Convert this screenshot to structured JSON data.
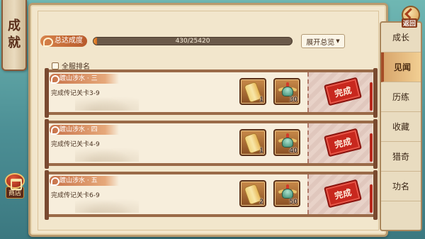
{
  "title_chars": [
    "成",
    "就"
  ],
  "shop": {
    "label": "商店"
  },
  "back": {
    "label": "返回"
  },
  "progress": {
    "label": "总达成度",
    "text": "430/25420",
    "fraction": 0.0169
  },
  "expand": {
    "label": "展开总览"
  },
  "server_rank": {
    "label": "全服排名"
  },
  "rows": [
    {
      "title": "踱山涉水 · 三",
      "desc": "完成传记关卡3-9",
      "reward1_count": "1",
      "reward2_count": "30",
      "stamp": "完成"
    },
    {
      "title": "踱山涉水 · 四",
      "desc": "完成传记关卡4-9",
      "reward1_count": "1",
      "reward2_count": "40",
      "stamp": "完成"
    },
    {
      "title": "踱山涉水 · 五",
      "desc": "完成传记关卡6-9",
      "reward1_count": "2",
      "reward2_count": "50",
      "stamp": "完成"
    }
  ],
  "nav": [
    "成长",
    "见闻",
    "历练",
    "收藏",
    "猎奇",
    "功名"
  ],
  "nav_active_index": 1
}
